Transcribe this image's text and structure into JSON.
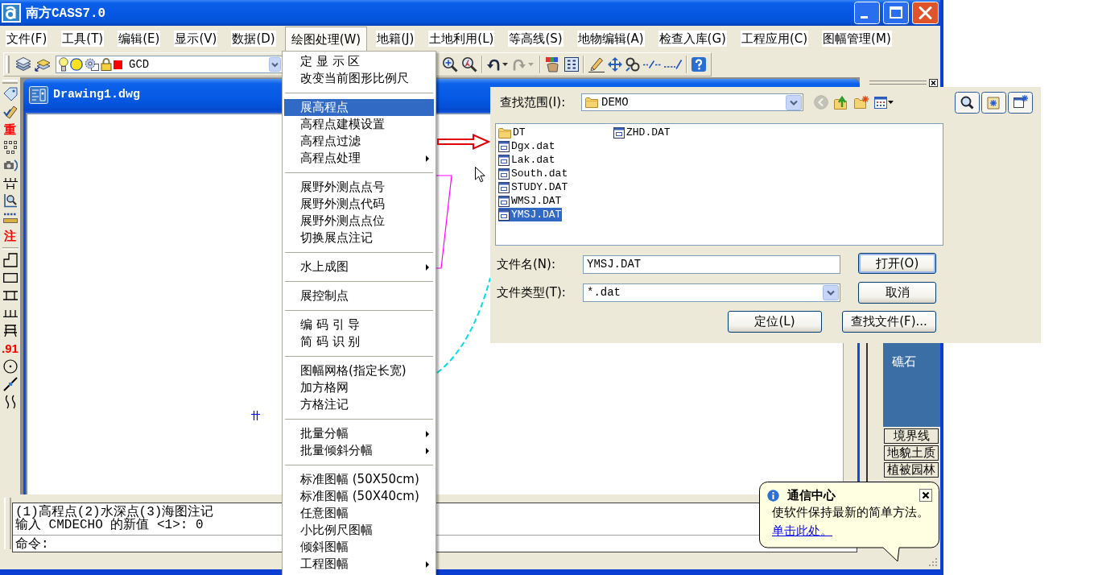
{
  "window": {
    "title": "南方CASS7.0"
  },
  "menu_bar": [
    {
      "label": "文件(F)",
      "selected": false
    },
    {
      "label": "工具(T)",
      "selected": false
    },
    {
      "label": "编辑(E)",
      "selected": false
    },
    {
      "label": "显示(V)",
      "selected": false
    },
    {
      "label": "数据(D)",
      "selected": false
    },
    {
      "label": "绘图处理(W)",
      "selected": true
    },
    {
      "label": "地籍(J)",
      "selected": false
    },
    {
      "label": "土地利用(L)",
      "selected": false
    },
    {
      "label": "等高线(S)",
      "selected": false
    },
    {
      "label": "地物编辑(A)",
      "selected": false
    },
    {
      "label": "检查入库(G)",
      "selected": false
    },
    {
      "label": "工程应用(C)",
      "selected": false
    },
    {
      "label": "图幅管理(M)",
      "selected": false
    }
  ],
  "toolbar": {
    "buttons": [
      {
        "disabled": false
      },
      {
        "disabled": false
      },
      {
        "disabled": false
      },
      {
        "disabled": false
      },
      {
        "disabled": false
      },
      {
        "disabled": false
      },
      {
        "disabled": true
      },
      {
        "disabled": true
      },
      {
        "disabled": false
      },
      {
        "disabled": false
      },
      {
        "disabled": false
      },
      {
        "disabled": false
      },
      {
        "disabled": false
      },
      {
        "disabled": false
      },
      {
        "disabled": false
      },
      {
        "disabled": false
      }
    ],
    "layer": {
      "name": "GCD",
      "color": "#ff0000"
    }
  },
  "left_toolbar": {
    "glyphs": [
      "重",
      "注",
      ".91"
    ]
  },
  "drawing_window": {
    "title": "Drawing1.dwg"
  },
  "dropdown_menu": {
    "items": [
      {
        "kind": "item",
        "label": "定 显 示 区",
        "selected": false,
        "submenu": false
      },
      {
        "kind": "item",
        "label": "改变当前图形比例尺",
        "selected": false,
        "submenu": false
      },
      {
        "kind": "separator"
      },
      {
        "kind": "item",
        "label": "展高程点",
        "selected": true,
        "submenu": false
      },
      {
        "kind": "item",
        "label": "高程点建模设置",
        "selected": false,
        "submenu": false
      },
      {
        "kind": "item",
        "label": "高程点过滤",
        "selected": false,
        "submenu": false
      },
      {
        "kind": "item",
        "label": "高程点处理",
        "selected": false,
        "submenu": true
      },
      {
        "kind": "separator"
      },
      {
        "kind": "item",
        "label": "展野外测点点号",
        "selected": false,
        "submenu": false
      },
      {
        "kind": "item",
        "label": "展野外测点代码",
        "selected": false,
        "submenu": false
      },
      {
        "kind": "item",
        "label": "展野外测点点位",
        "selected": false,
        "submenu": false
      },
      {
        "kind": "item",
        "label": "切换展点注记",
        "selected": false,
        "submenu": false
      },
      {
        "kind": "separator"
      },
      {
        "kind": "item",
        "label": "水上成图",
        "selected": false,
        "submenu": true
      },
      {
        "kind": "separator"
      },
      {
        "kind": "item",
        "label": "展控制点",
        "selected": false,
        "submenu": false
      },
      {
        "kind": "separator"
      },
      {
        "kind": "item",
        "label": "编 码 引 导",
        "selected": false,
        "submenu": false
      },
      {
        "kind": "item",
        "label": "简 码 识 别",
        "selected": false,
        "submenu": false
      },
      {
        "kind": "separator"
      },
      {
        "kind": "item",
        "label": "图幅网格(指定长宽)",
        "selected": false,
        "submenu": false
      },
      {
        "kind": "item",
        "label": "加方格网",
        "selected": false,
        "submenu": false
      },
      {
        "kind": "item",
        "label": "方格注记",
        "selected": false,
        "submenu": false
      },
      {
        "kind": "separator"
      },
      {
        "kind": "item",
        "label": "批量分幅",
        "selected": false,
        "submenu": true
      },
      {
        "kind": "item",
        "label": "批量倾斜分幅",
        "selected": false,
        "submenu": true
      },
      {
        "kind": "separator"
      },
      {
        "kind": "item",
        "label": "标准图幅 (50X50cm)",
        "selected": false,
        "submenu": false
      },
      {
        "kind": "item",
        "label": "标准图幅 (50X40cm)",
        "selected": false,
        "submenu": false
      },
      {
        "kind": "item",
        "label": "任意图幅",
        "selected": false,
        "submenu": false
      },
      {
        "kind": "item",
        "label": "小比例尺图幅",
        "selected": false,
        "submenu": false
      },
      {
        "kind": "item",
        "label": "倾斜图幅",
        "selected": false,
        "submenu": false
      },
      {
        "kind": "item",
        "label": "工程图幅",
        "selected": false,
        "submenu": true
      }
    ]
  },
  "tool_palette": {
    "items": [
      "礁石"
    ],
    "tabs": [
      "境界线",
      "地貌土质",
      "植被园林"
    ]
  },
  "command_line": {
    "history": [
      "(1)高程点(2)水深点(3)海图注记",
      "输入 CMDECHO 的新值 <1>: 0"
    ],
    "prompt": "命令:"
  },
  "open_dialog": {
    "look_in_label": "查找范围(I):",
    "look_in_value": "DEMO",
    "nav_buttons": [
      {
        "disabled": true
      },
      {
        "disabled": false
      },
      {
        "disabled": false
      },
      {
        "disabled": false
      }
    ],
    "files": [
      {
        "name": "DT",
        "kind": "folder",
        "selected": false
      },
      {
        "name": "Dgx.dat",
        "kind": "file",
        "selected": false
      },
      {
        "name": "Lak.dat",
        "kind": "file",
        "selected": false
      },
      {
        "name": "South.dat",
        "kind": "file",
        "selected": false
      },
      {
        "name": "STUDY.DAT",
        "kind": "file",
        "selected": false
      },
      {
        "name": "WMSJ.DAT",
        "kind": "file",
        "selected": false
      },
      {
        "name": "YMSJ.DAT",
        "kind": "file",
        "selected": true
      },
      {
        "name": "ZHD.DAT",
        "kind": "file",
        "selected": false
      }
    ],
    "file_name_label": "文件名(N):",
    "file_name_value": "YMSJ.DAT",
    "file_type_label": "文件类型(T):",
    "file_type_value": "*.dat",
    "buttons": [
      {
        "label": "打开(O)",
        "default": true
      },
      {
        "label": "取消",
        "default": false
      },
      {
        "label": "定位(L)",
        "default": false
      },
      {
        "label": "查找文件(F)...",
        "default": false
      }
    ]
  },
  "notification": {
    "title": "通信中心",
    "message": "使软件保持最新的简单方法。",
    "link": "单击此处。"
  }
}
